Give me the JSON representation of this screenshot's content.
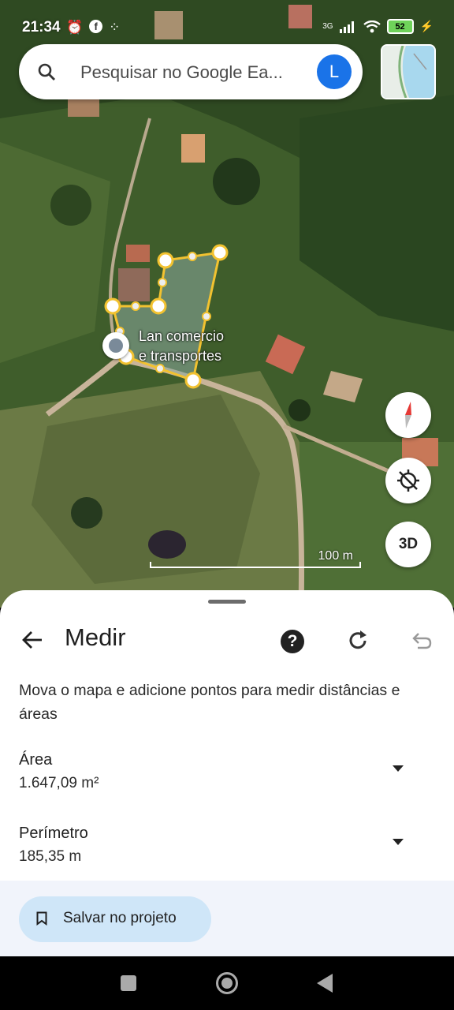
{
  "status_bar": {
    "time": "21:34",
    "network": "3G",
    "battery": "52",
    "icons": [
      "alarm-icon",
      "facebook-icon",
      "app-icon",
      "signal-icon",
      "wifi-icon",
      "battery-icon",
      "charging-icon"
    ]
  },
  "search": {
    "placeholder": "Pesquisar no Google Ea...",
    "avatar_letter": "L"
  },
  "map": {
    "place_label_line1": "Lan comercio",
    "place_label_line2": "e transportes",
    "scale_label": "100 m",
    "button_3d": "3D",
    "polygon_color": "#f2c230"
  },
  "sheet": {
    "title": "Medir",
    "help_symbol": "?",
    "instruction": "Mova o mapa e adicione pontos para medir distâncias e áreas",
    "area_label": "Área",
    "area_value": "1.647,09 m²",
    "perimeter_label": "Perímetro",
    "perimeter_value": "185,35 m",
    "save_button": "Salvar no projeto"
  },
  "colors": {
    "accent": "#1a73e8",
    "save_button_bg": "#cfe6f8",
    "footer_bg": "#f1f4fb"
  }
}
